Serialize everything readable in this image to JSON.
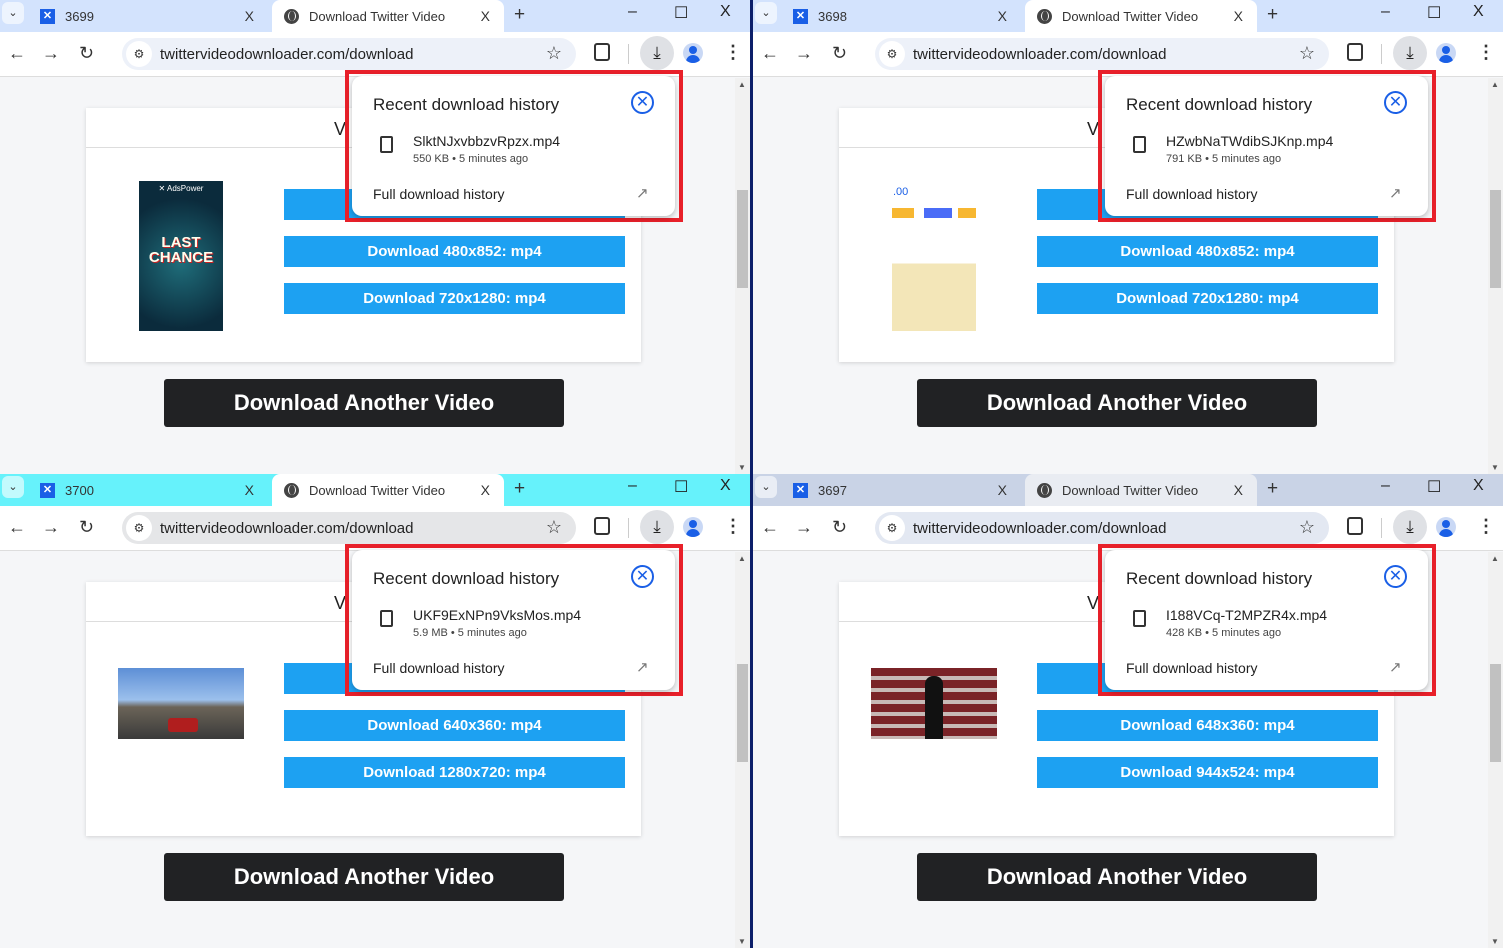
{
  "common": {
    "active_tab": "Download Twitter Video",
    "url": "twittervideodownloader.com/download",
    "card_heading": "Vi",
    "popup_title": "Recent download history",
    "full_history": "Full download history",
    "another_button": "Download Another Video",
    "new_tab": "+",
    "tab_close": "X",
    "min": "–",
    "max": "☐",
    "close": "X"
  },
  "windows": [
    {
      "profile_tab": "3699",
      "tabbar_color": "#d3e3fd",
      "active_tab_color": "#ffffff",
      "omni_color": "#edf1f9",
      "file": "SlktNJxvbbzvRpzx.mp4",
      "meta": "550 KB • 5 minutes ago",
      "buttons": [
        "",
        "Download 480x852: mp4",
        "Download 720x1280: mp4"
      ],
      "thumb": "adspower-ad",
      "thumb_text": "LAST CHANCE"
    },
    {
      "profile_tab": "3698",
      "tabbar_color": "#d3e3fd",
      "active_tab_color": "#ffffff",
      "omni_color": "#edf1f9",
      "file": "HZwbNaTWdibSJKnp.mp4",
      "meta": "791 KB • 5 minutes ago",
      "buttons": [
        "",
        "Download 480x852: mp4",
        "Download 720x1280: mp4"
      ],
      "thumb": "app-screenshot",
      "thumb_text": ".00"
    },
    {
      "profile_tab": "3700",
      "tabbar_color": "#66f2fb",
      "active_tab_color": "#ffffff",
      "omni_color": "#e5e6e8",
      "file": "UKF9ExNPn9VksMos.mp4",
      "meta": "5.9 MB • 5 minutes ago",
      "buttons": [
        "",
        "Download 640x360: mp4",
        "Download 1280x720: mp4"
      ],
      "thumb": "street-photo",
      "thumb_text": ""
    },
    {
      "profile_tab": "3697",
      "tabbar_color": "#c9d3e6",
      "active_tab_color": "#e9ecf2",
      "omni_color": "#e3e8f2",
      "file": "I188VCq-T2MPZR4x.mp4",
      "meta": "428 KB • 5 minutes ago",
      "buttons": [
        "",
        "Download 648x360: mp4",
        "Download 944x524: mp4"
      ],
      "thumb": "speaker-photo",
      "thumb_text": ""
    }
  ]
}
